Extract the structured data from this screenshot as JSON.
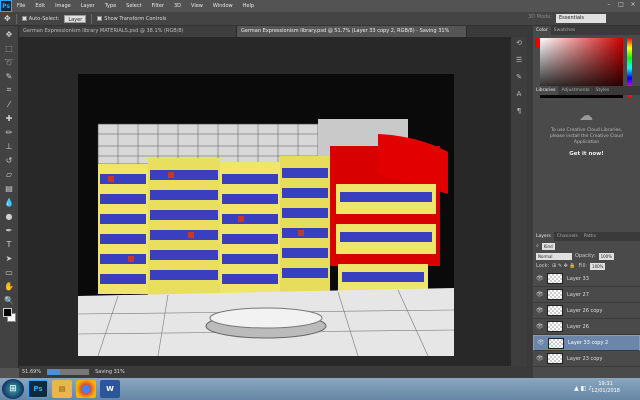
{
  "menubar": {
    "logo": "Ps",
    "items": [
      "File",
      "Edit",
      "Image",
      "Layer",
      "Type",
      "Select",
      "Filter",
      "3D",
      "View",
      "Window",
      "Help"
    ]
  },
  "options": {
    "auto_select": "Auto-Select:",
    "auto_select_value": "Layer",
    "transform": "Show Transform Controls",
    "mode_3d": "3D Mode:",
    "workspace": "Essentials"
  },
  "tabs": [
    {
      "label": "German Expressionism library MATERIALS.psd @ 38.1% (RGB/8)",
      "active": false
    },
    {
      "label": "German Expressionism library.psd @ 51.7% (Layer 33 copy 2, RGB/8) - Saving 31%",
      "active": true
    }
  ],
  "status": {
    "zoom": "51.69%",
    "saving": "Saving 31%",
    "progress": 0.31
  },
  "panels": {
    "color_tabs": [
      "Color",
      "Swatches"
    ],
    "library_tabs": [
      "Libraries",
      "Adjustments",
      "Styles"
    ],
    "library_message": "To use Creative Cloud Libraries, please install the Creative Cloud Application",
    "get_it": "Get it now!",
    "layer_tabs": [
      "Layers",
      "Channels",
      "Paths"
    ],
    "kind": "Kind",
    "blend": "Normal",
    "opacity_label": "Opacity:",
    "opacity": "100%",
    "lock_label": "Lock:",
    "fill_label": "Fill:",
    "fill": "100%"
  },
  "layers": [
    {
      "name": "Layer 33",
      "selected": false
    },
    {
      "name": "Layer 27",
      "selected": false
    },
    {
      "name": "Layer 26 copy",
      "selected": false
    },
    {
      "name": "Layer 26",
      "selected": false
    },
    {
      "name": "Layer 33 copy 2",
      "selected": true
    },
    {
      "name": "Layer 23 copy",
      "selected": false
    }
  ],
  "taskbar": {
    "apps": [
      "Ps",
      "W"
    ],
    "time": "19:31",
    "date": "12/01/2018"
  },
  "colors": {
    "accent": "#31a8ff",
    "selection": "#6b86a8",
    "canvas_bg": "#282828"
  }
}
